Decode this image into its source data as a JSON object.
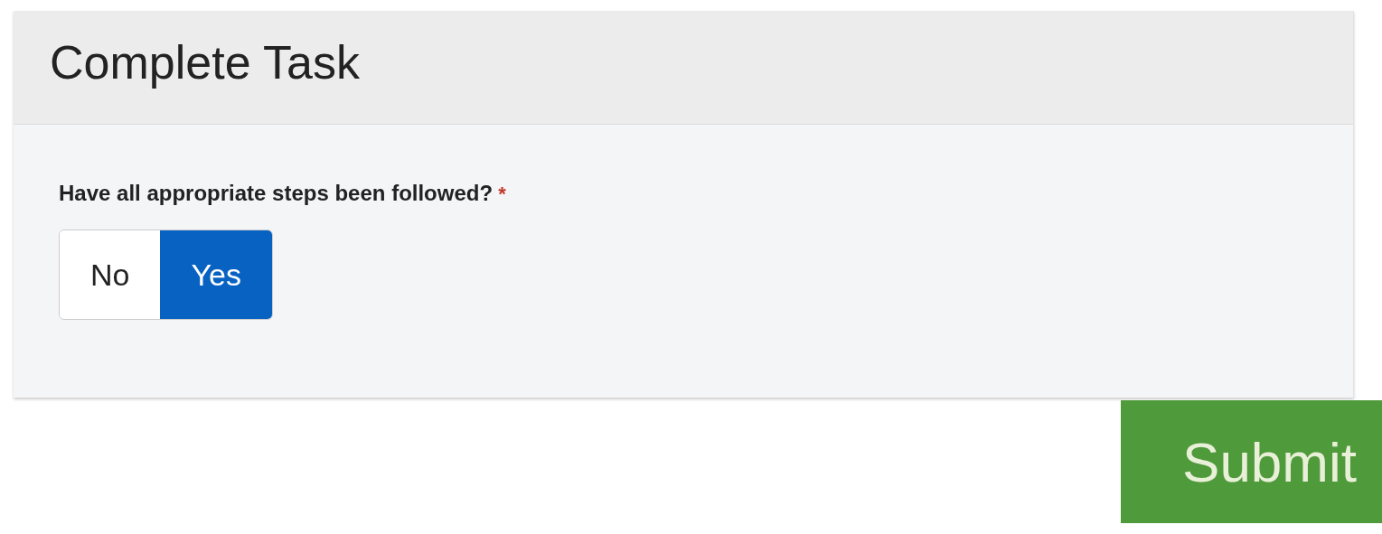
{
  "panel": {
    "title": "Complete Task",
    "question": {
      "label": "Have all appropriate steps been followed?",
      "required_mark": "*",
      "options": [
        {
          "label": "No",
          "selected": false
        },
        {
          "label": "Yes",
          "selected": true
        }
      ]
    }
  },
  "submit": {
    "label": "Submit"
  }
}
